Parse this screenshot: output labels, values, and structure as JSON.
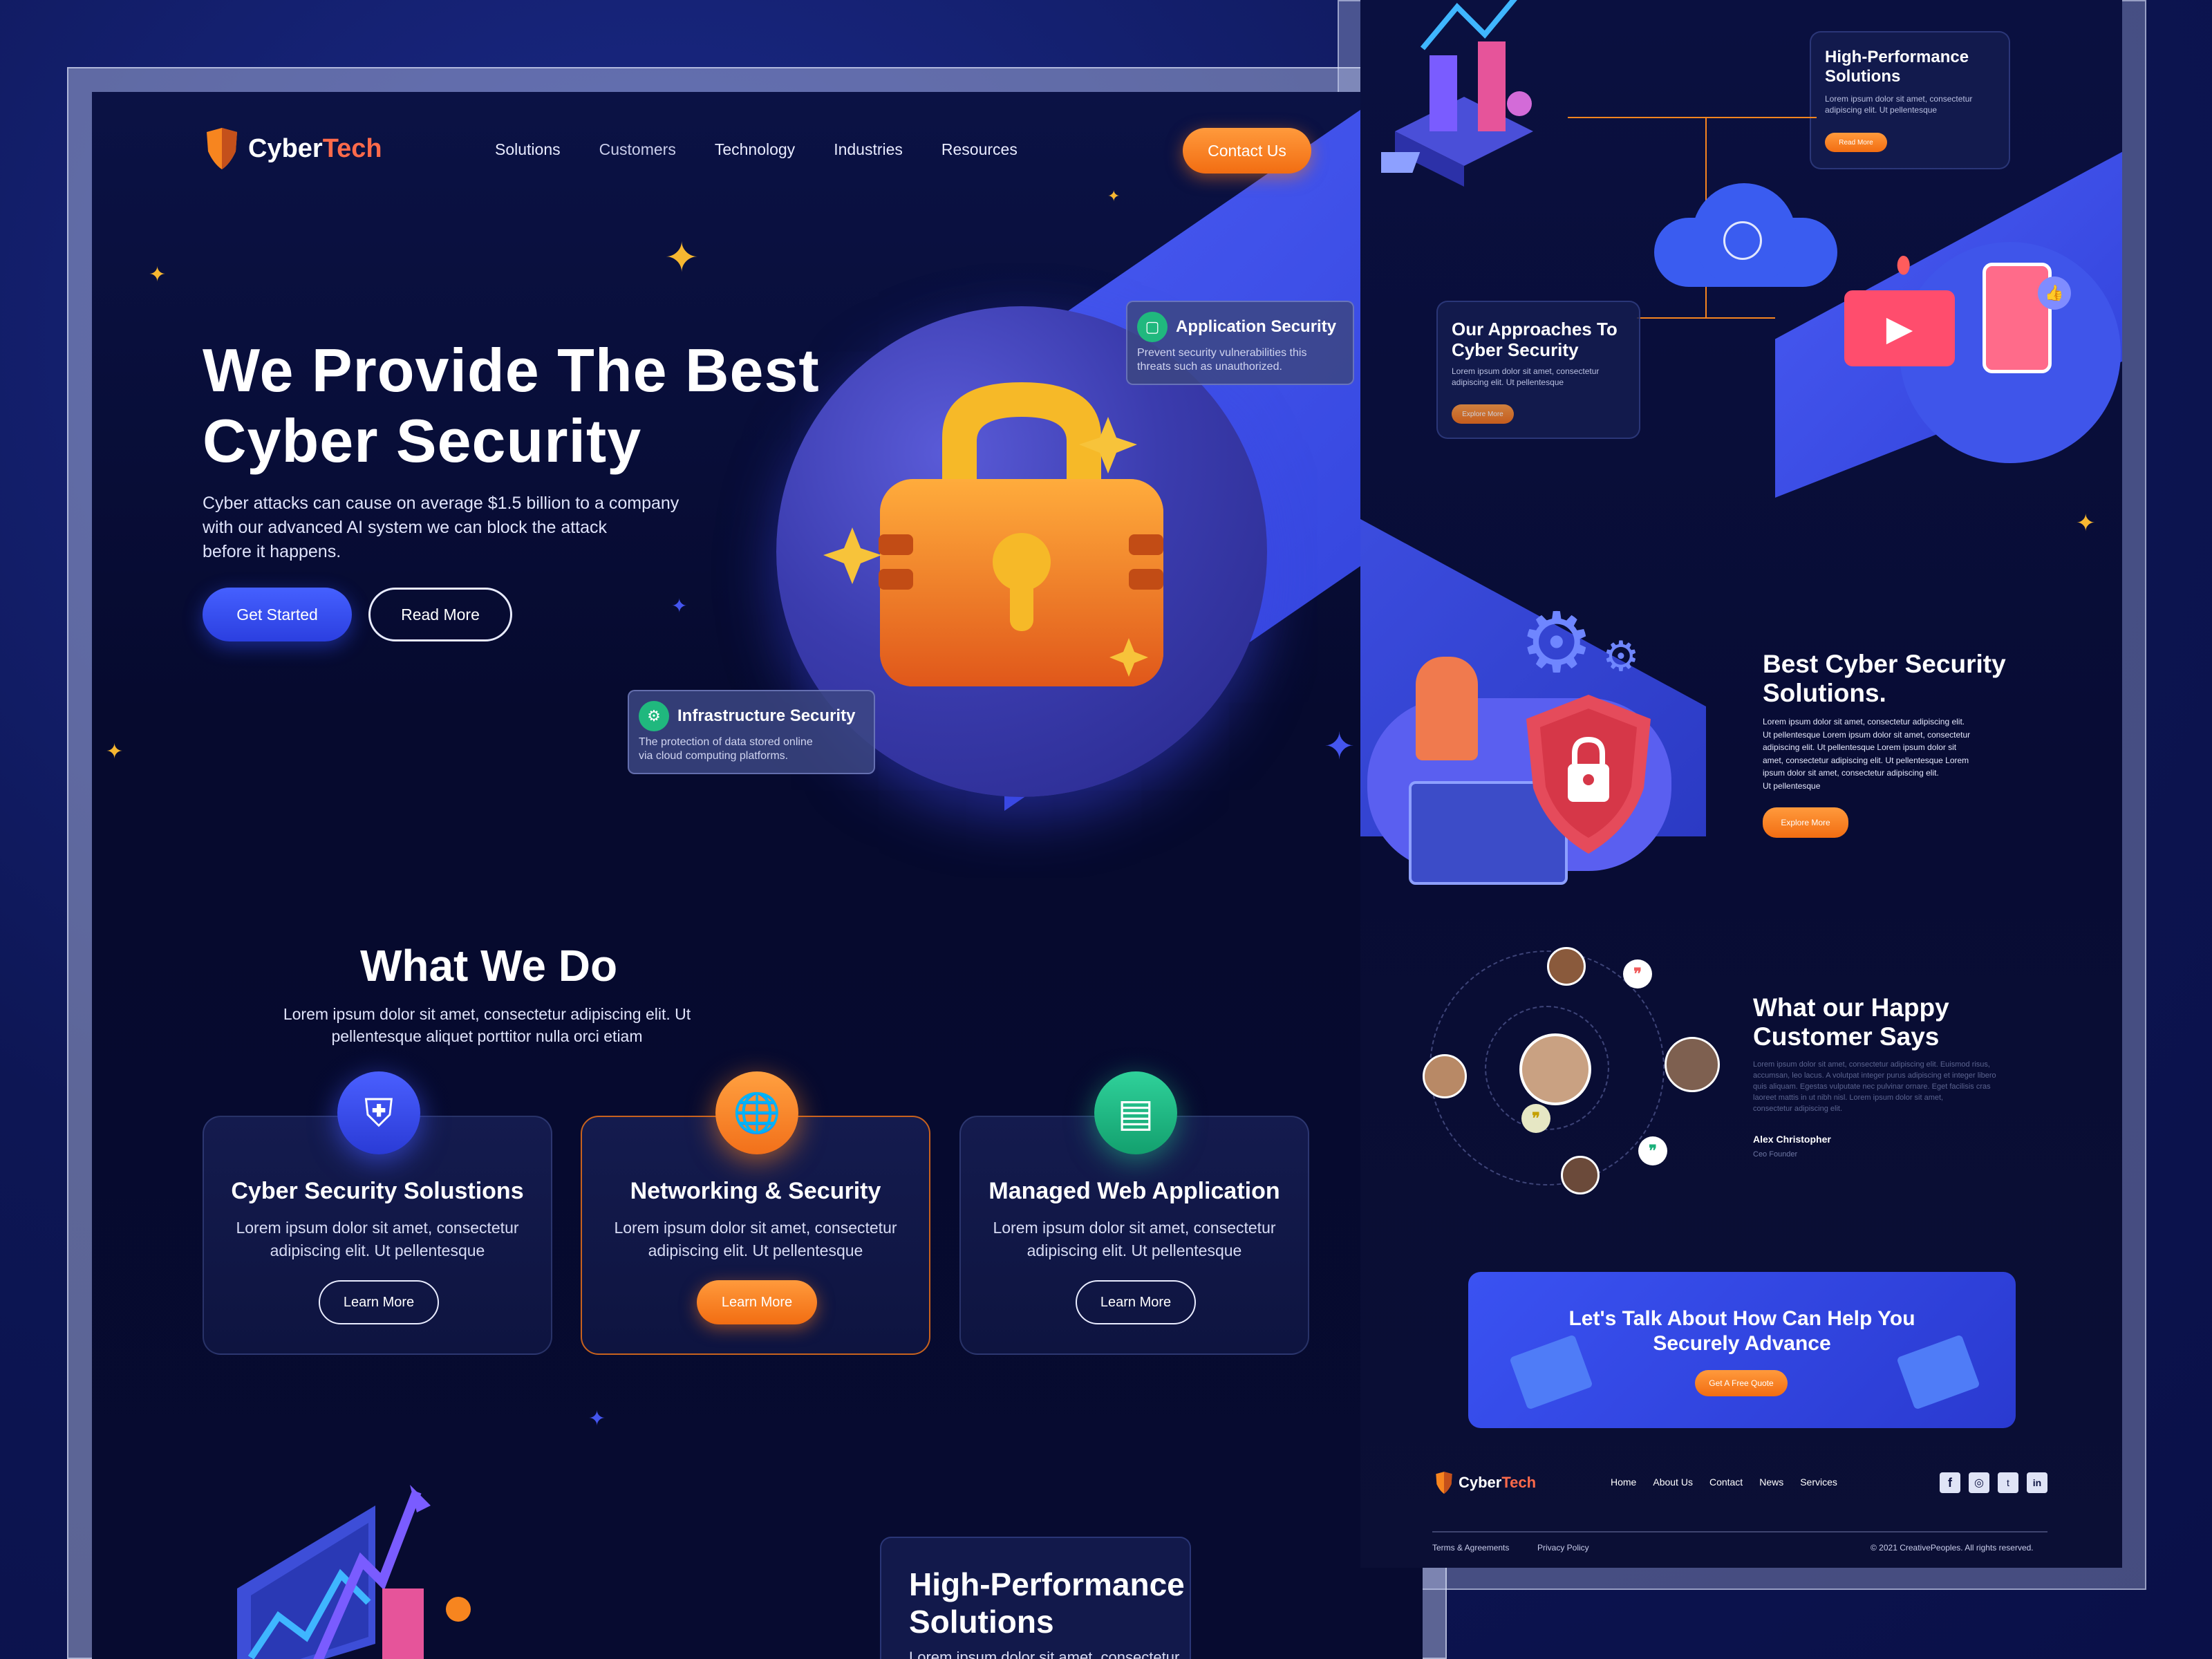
{
  "brand": {
    "name_part1": "Cyber",
    "name_part2": "Tech"
  },
  "nav": {
    "items": [
      "Solutions",
      "Customers",
      "Technology",
      "Industries",
      "Resources"
    ],
    "contact": "Contact Us"
  },
  "hero": {
    "title_line1": "We Provide The Best",
    "title_line2": "Cyber Security",
    "desc_line1": "Cyber attacks can cause on average $1.5 billion to a company",
    "desc_line2": "with our advanced AI system we can block the attack",
    "desc_line3": "before it happens.",
    "get_started": "Get Started",
    "read_more": "Read More",
    "app_sec_title": "Application Security",
    "app_sec_line1": "Prevent security vulnerabilities this",
    "app_sec_line2": "threats such as unauthorized.",
    "infra_title": "Infrastructure Security",
    "infra_line1": "The protection of data stored online",
    "infra_line2": "via cloud computing platforms."
  },
  "what_we_do": {
    "title": "What We Do",
    "desc_line1": "Lorem ipsum dolor sit amet, consectetur adipiscing elit. Ut",
    "desc_line2": "pellentesque aliquet porttitor nulla orci etiam",
    "cards": [
      {
        "title": "Cyber Security Solustions",
        "line1": "Lorem ipsum dolor sit amet, consectetur",
        "line2": "adipiscing elit. Ut pellentesque",
        "button": "Learn More",
        "icon": "network-shield-icon"
      },
      {
        "title": "Networking & Security",
        "line1": "Lorem ipsum dolor sit amet, consectetur",
        "line2": "adipiscing elit. Ut pellentesque",
        "button": "Learn More",
        "icon": "globe-icon"
      },
      {
        "title": "Managed Web Application",
        "line1": "Lorem ipsum dolor sit amet, consectetur",
        "line2": "adipiscing elit. Ut pellentesque",
        "button": "Learn More",
        "icon": "web-app-icon"
      }
    ]
  },
  "high_perf": {
    "title_line1": "High-Performance",
    "title_line2": "Solutions",
    "text": "Lorem ipsum dolor sit amet, consectetur"
  },
  "right": {
    "hp_title_line1": "High-Performance",
    "hp_title_line2": "Solutions",
    "hp_line1": "Lorem ipsum dolor sit amet, consectetur",
    "hp_line2": "adipiscing elit. Ut pellentesque",
    "hp_btn": "Read More",
    "approach_title_line1": "Our Approaches To",
    "approach_title_line2": "Cyber Security",
    "approach_line1": "Lorem ipsum dolor sit amet, consectetur",
    "approach_line2": "adipiscing elit. Ut pellentesque",
    "approach_btn": "Explore More",
    "best_title_line1": "Best Cyber Security",
    "best_title_line2": "Solutions.",
    "best_lines": [
      "Lorem ipsum dolor sit amet, consectetur adipiscing elit.",
      "Ut pellentesque Lorem ipsum dolor sit amet, consectetur",
      "adipiscing elit. Ut pellentesque Lorem ipsum dolor sit",
      "amet, consectetur adipiscing elit. Ut pellentesque Lorem",
      "ipsum dolor sit amet, consectetur adipiscing elit.",
      "Ut pellentesque"
    ],
    "best_btn": "Explore More",
    "testi_title_line1": "What our Happy",
    "testi_title_line2": "Customer Says",
    "testi_lines": [
      "Lorem ipsum dolor sit amet, consectetur adipiscing elit. Euismod risus,",
      "accumsan, leo lacus. A volutpat integer purus adipiscing et integer libero",
      "quis aliquam. Egestas vulputate nec pulvinar ornare. Eget facilisis cras",
      "laoreet mattis in ut nibh nisl. Lorem ipsum dolor sit amet,",
      "consectetur adipiscing elit."
    ],
    "author": "Alex Christopher",
    "author_role": "Ceo Founder",
    "cta_line1": "Let's Talk About How Can Help You",
    "cta_line2": "Securely Advance",
    "cta_btn": "Get A Free Quote",
    "footer_brand_1": "Cyber",
    "footer_brand_2": "Tech",
    "footer_links": [
      "Home",
      "About Us",
      "Contact",
      "News",
      "Services"
    ],
    "footer_terms": "Terms & Agreements",
    "footer_privacy": "Privacy Policy",
    "footer_copy": "© 2021 CreativePeoples. All rights reserved."
  },
  "colors": {
    "accent_orange": "#f7851f",
    "accent_blue": "#3a4ff0",
    "bg_navy": "#070b30"
  }
}
